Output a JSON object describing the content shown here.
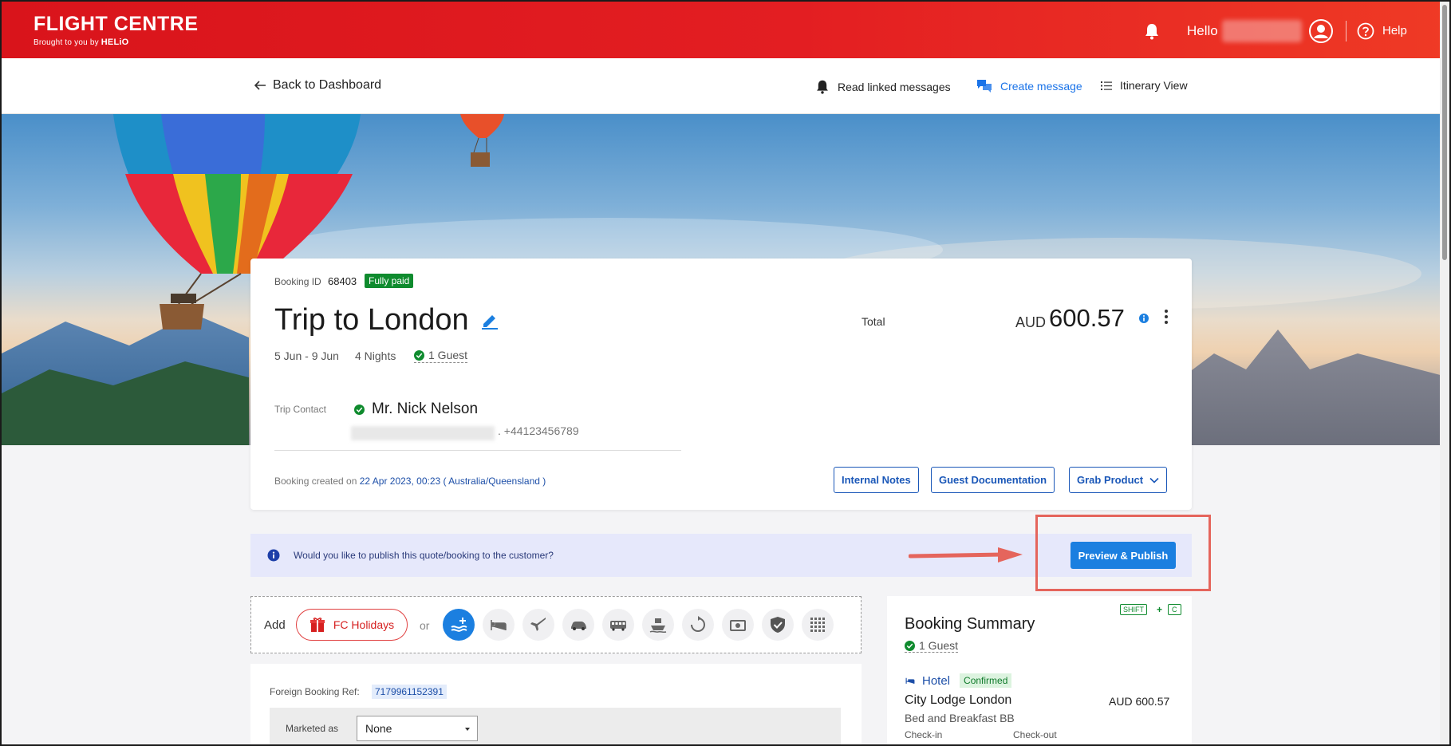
{
  "header": {
    "logo_main": "FLIGHT CENTRE",
    "logo_sub": "Brought to you by",
    "logo_sub_brand": "HELiO",
    "greeting": "Hello",
    "help_label": "Help"
  },
  "subnav": {
    "back_label": "Back to Dashboard",
    "read_messages_label": "Read linked messages",
    "create_message_label": "Create message",
    "itinerary_label": "Itinerary View"
  },
  "booking": {
    "id_label": "Booking ID",
    "id_value": "68403",
    "status_badge": "Fully paid",
    "title": "Trip to London",
    "dates": "5 Jun - 9 Jun",
    "nights": "4 Nights",
    "guests": "1 Guest",
    "total_label": "Total",
    "total_currency": "AUD",
    "total_amount": "600.57",
    "trip_contact_label": "Trip Contact",
    "trip_contact_name": "Mr. Nick Nelson",
    "trip_contact_phone": ". +44123456789",
    "created_label": "Booking created on",
    "created_value": "22 Apr 2023, 00:23 ( Australia/Queensland )",
    "buttons": {
      "internal_notes": "Internal Notes",
      "guest_documentation": "Guest Documentation",
      "grab_product": "Grab Product"
    }
  },
  "publish_banner": {
    "text": "Would you like to publish this quote/booking to the customer?",
    "button_label": "Preview & Publish"
  },
  "add_bar": {
    "add_label": "Add",
    "fc_holidays_label": "FC Holidays",
    "or_label": "or",
    "product_icons": [
      "activity-add-icon",
      "hotel-bed-icon",
      "flight-icon",
      "car-icon",
      "bus-icon",
      "ferry-icon",
      "transfer-icon",
      "cash-icon",
      "insurance-shield-icon",
      "more-grid-icon"
    ]
  },
  "detail": {
    "foreign_ref_label": "Foreign Booking Ref:",
    "foreign_ref_value": "7179961152391",
    "marketed_label": "Marketed as",
    "marketed_value": "None"
  },
  "summary": {
    "shortcut_key1": "SHIFT",
    "shortcut_plus": "+",
    "shortcut_key2": "C",
    "title": "Booking Summary",
    "guests": "1 Guest",
    "item_type": "Hotel",
    "item_status": "Confirmed",
    "hotel_name": "City Lodge London",
    "hotel_price": "AUD 600.57",
    "hotel_board": "Bed and Breakfast BB",
    "check_in_label": "Check-in",
    "check_out_label": "Check-out"
  },
  "colors": {
    "brand_red": "#e31e22",
    "primary_blue": "#1b7fe0",
    "paid_green": "#0f8b2e",
    "annotation_red": "#e5655c"
  }
}
